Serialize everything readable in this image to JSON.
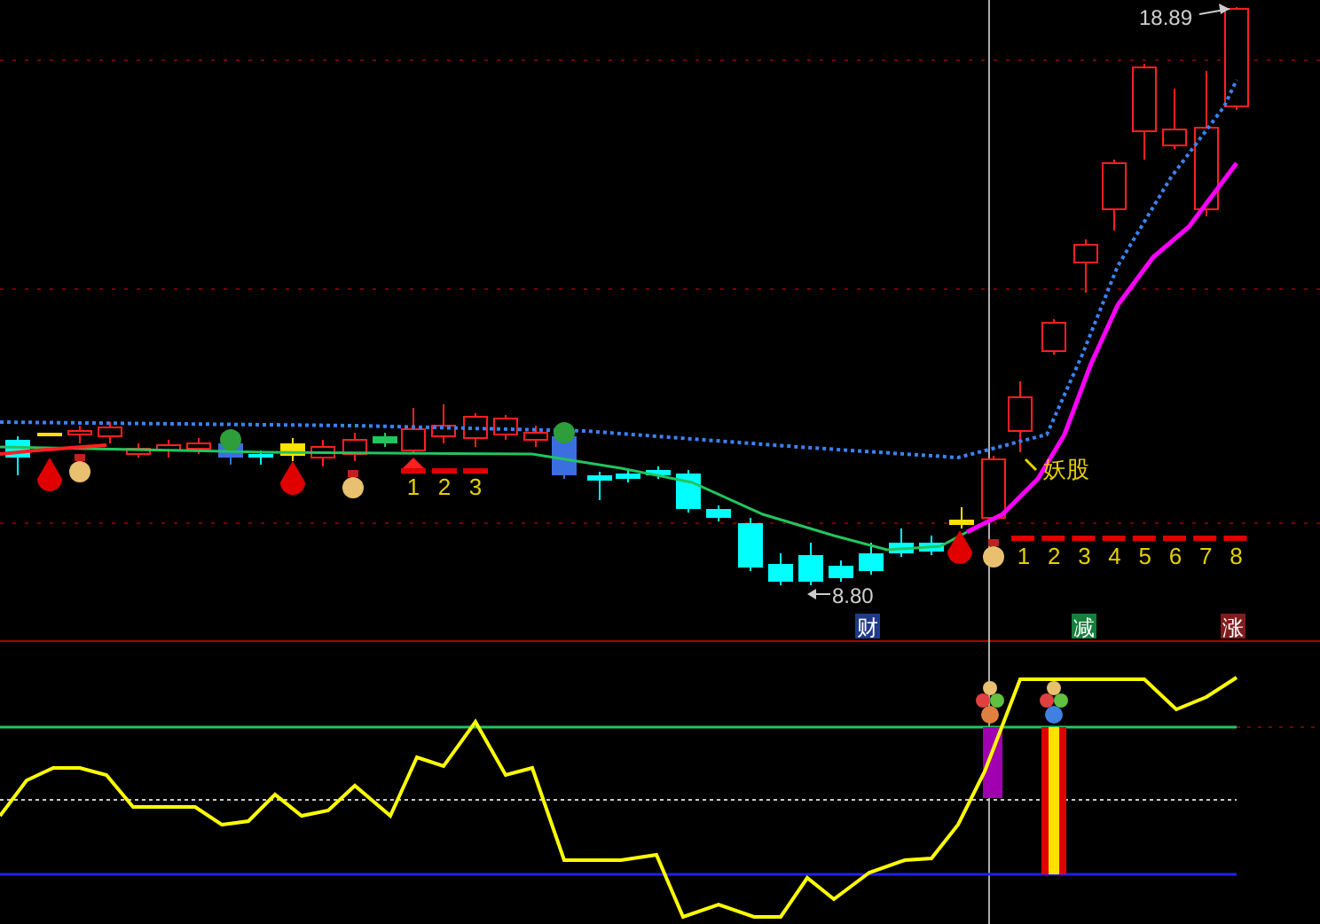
{
  "price_chart": {
    "high_label": "18.89",
    "low_label": "8.80",
    "tag_label": "妖股",
    "signal_counts": [
      "1",
      "2",
      "3"
    ],
    "day_counts": [
      "1",
      "2",
      "3",
      "4",
      "5",
      "6",
      "7",
      "8"
    ]
  },
  "marker_row": [
    {
      "label": "财",
      "color": "#1e3a8a"
    },
    {
      "label": "减",
      "color": "#15803d"
    },
    {
      "label": "涨",
      "color": "#7f1d1d"
    }
  ]
}
